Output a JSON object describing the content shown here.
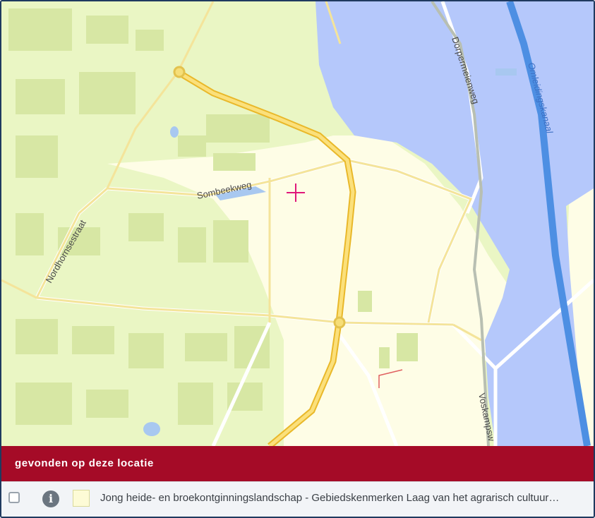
{
  "map": {
    "streets": [
      {
        "id": "sombeekweg",
        "label": "Sombeekweg"
      },
      {
        "id": "nordhornsestraat",
        "label": "Nordhornsestraat"
      },
      {
        "id": "dorpermeienweg",
        "label": "Dorpermeienweg"
      },
      {
        "id": "omleidingskanaal",
        "label": "Omleidingskanaal"
      },
      {
        "id": "voskampsweg",
        "label": "Voskampsw"
      }
    ],
    "marker_icon": "crosshair-icon",
    "colors": {
      "base_green": "#eaf6c4",
      "landscape_yellow": "#fefde6",
      "water_blue": "#b5c8fb",
      "highway": "#f0c63a",
      "canal": "#4d8fe3",
      "marker": "#e0177a"
    }
  },
  "panel": {
    "title": "gevonden op deze locatie",
    "header_color": "#a50b27",
    "results": [
      {
        "checked": false,
        "info_icon": "info-icon",
        "swatch_color": "#fdfbd6",
        "label": "Jong heide- en broekontginningslandschap - Gebiedskenmerken Laag van het agrarisch cultuur…"
      }
    ]
  }
}
